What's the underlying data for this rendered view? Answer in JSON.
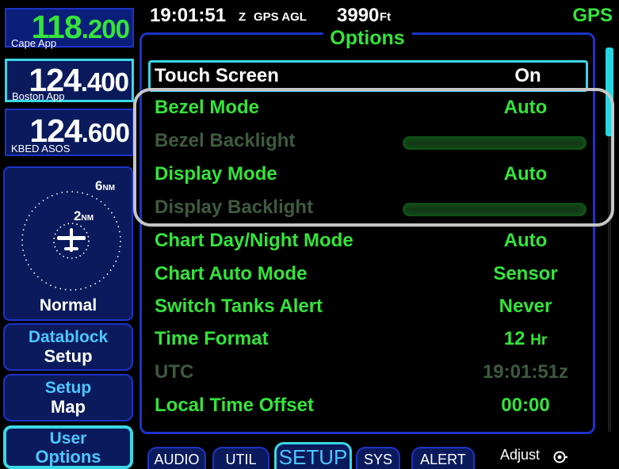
{
  "radios": {
    "active": {
      "mhz": "118",
      "khz": ".200",
      "label": "Cape App"
    },
    "standby": {
      "mhz": "124",
      "khz": ".400",
      "label": "Boston App"
    },
    "wx": {
      "mhz": "124",
      "khz": ".600",
      "label": "KBED ASOS"
    }
  },
  "mini_map": {
    "outer_range": "6",
    "inner_range": "2",
    "range_unit": "NM",
    "mode": "Normal"
  },
  "left_buttons": [
    {
      "top": "Datablock",
      "bottom": "Setup"
    },
    {
      "top": "Setup",
      "bottom": "Map"
    },
    {
      "top": "User",
      "bottom": "Options"
    }
  ],
  "status_bar": {
    "time": "19:01:51",
    "zone": "Z",
    "agl_label": "GPS AGL",
    "agl_value": "3990",
    "agl_unit": "Ft",
    "nav_source": "GPS"
  },
  "options": {
    "title": "Options",
    "rows": [
      {
        "label": "Touch Screen",
        "value": "On"
      },
      {
        "label": "Bezel Mode",
        "value": "Auto"
      },
      {
        "label": "Bezel Backlight",
        "value": ""
      },
      {
        "label": "Display Mode",
        "value": "Auto"
      },
      {
        "label": "Display Backlight",
        "value": ""
      },
      {
        "label": "Chart Day/Night Mode",
        "value": "Auto"
      },
      {
        "label": "Chart Auto Mode",
        "value": "Sensor"
      },
      {
        "label": "Switch Tanks Alert",
        "value": "Never"
      },
      {
        "label": "Time Format",
        "value": "12",
        "unit": "Hr"
      },
      {
        "label": "UTC",
        "value": "19:01:51z"
      },
      {
        "label": "Local Time Offset",
        "value": "00:00"
      }
    ]
  },
  "tabs": [
    "AUDIO",
    "UTIL",
    "SETUP",
    "SYS",
    "ALERT"
  ],
  "adjust_label": "Adjust",
  "colors": {
    "active_green": "#34e43b",
    "disabled_green": "#3e5a40",
    "cyan_highlight": "#3ad7e6",
    "button_blue": "#0a1a5c",
    "border_blue": "#1e33c8",
    "label_blue": "#4cc7ff",
    "callout_gray": "#c6c6c6"
  }
}
